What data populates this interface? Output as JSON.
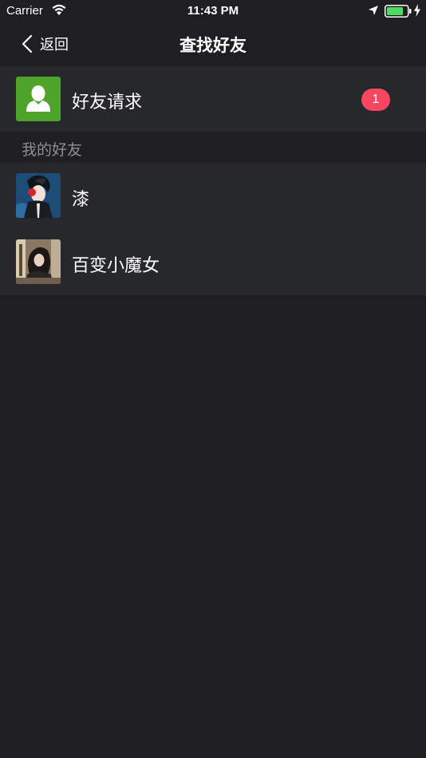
{
  "status_bar": {
    "carrier": "Carrier",
    "time": "11:43 PM",
    "battery_color": "#4cd964"
  },
  "nav": {
    "back_label": "返回",
    "title": "查找好友"
  },
  "friend_requests": {
    "label": "好友请求",
    "badge_count": "1",
    "icon_color": "#4ea42a",
    "badge_color": "#f7465f"
  },
  "friends_section": {
    "header": "我的好友",
    "friends": [
      {
        "name": "漆",
        "avatar": "avatar-anime-boy"
      },
      {
        "name": "百变小魔女",
        "avatar": "avatar-photo-girl"
      }
    ]
  },
  "icons": {
    "back": "chevron-left-icon",
    "request": "person-silhouette-icon",
    "wifi": "wifi-icon",
    "location": "location-arrow-icon",
    "battery": "battery-icon",
    "charging": "bolt-icon"
  }
}
